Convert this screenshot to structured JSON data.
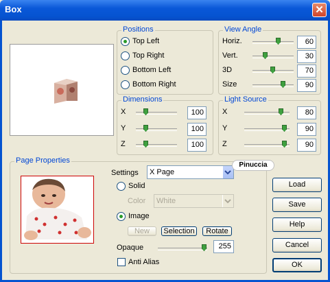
{
  "window": {
    "title": "Box",
    "close_glyph": "✕"
  },
  "positions": {
    "legend": "Positions",
    "options": [
      {
        "label": "Top Left",
        "selected": true
      },
      {
        "label": "Top Right",
        "selected": false
      },
      {
        "label": "Bottom Left",
        "selected": false
      },
      {
        "label": "Bottom Right",
        "selected": false
      }
    ]
  },
  "view_angle": {
    "legend": "View Angle",
    "rows": [
      {
        "label": "Horiz.",
        "value": "60"
      },
      {
        "label": "Vert.",
        "value": "30"
      },
      {
        "label": "3D",
        "value": "70"
      },
      {
        "label": "Size",
        "value": "90"
      }
    ]
  },
  "dimensions": {
    "legend": "Dimensions",
    "rows": [
      {
        "label": "X",
        "value": "100"
      },
      {
        "label": "Y",
        "value": "100"
      },
      {
        "label": "Z",
        "value": "100"
      }
    ]
  },
  "light_source": {
    "legend": "Light Source",
    "rows": [
      {
        "label": "X",
        "value": "80"
      },
      {
        "label": "Y",
        "value": "90"
      },
      {
        "label": "Z",
        "value": "90"
      }
    ]
  },
  "page_properties": {
    "legend": "Page Properties",
    "settings_label": "Settings",
    "settings_value": "X Page",
    "solid_label": "Solid",
    "color_label": "Color",
    "color_value": "White",
    "image_label": "Image",
    "new_label": "New",
    "selection_label": "Selection",
    "rotate_label": "Rotate",
    "opaque_label": "Opaque",
    "opaque_value": "255",
    "anti_alias_label": "Anti Alias"
  },
  "watermark": "Pinuccia",
  "buttons": {
    "load": "Load",
    "save": "Save",
    "help": "Help",
    "cancel": "Cancel",
    "ok": "OK"
  },
  "colors": {
    "accent": "#0046d5",
    "titlebar": "#0553d0",
    "face": "#ECE9D8"
  }
}
